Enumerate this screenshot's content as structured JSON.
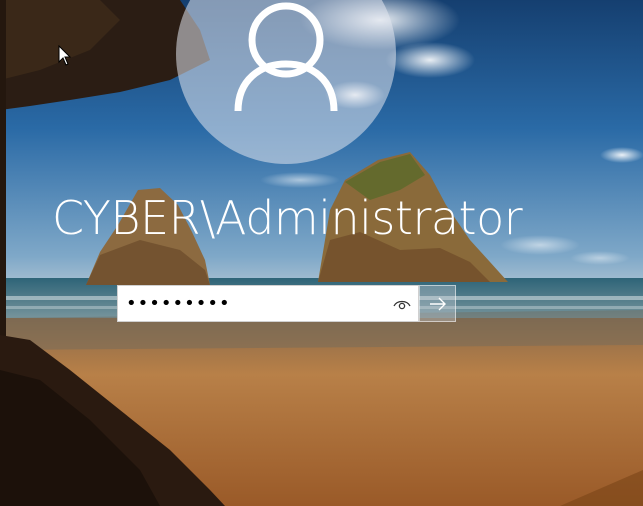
{
  "login": {
    "username": "CYBER\\Administrator",
    "password_value": "•••••••••",
    "reveal_icon": "eye-icon",
    "submit_icon": "arrow-right-icon"
  },
  "avatar": {
    "icon": "user-silhouette-icon"
  },
  "background": {
    "description_icon": "beach-cave-wallpaper"
  },
  "colors": {
    "sky_top": "#1a4f86",
    "sky_horizon": "#6d9fc8",
    "sand": "#b07a3c",
    "cave": "#2a1a10",
    "text": "#ffffff"
  }
}
